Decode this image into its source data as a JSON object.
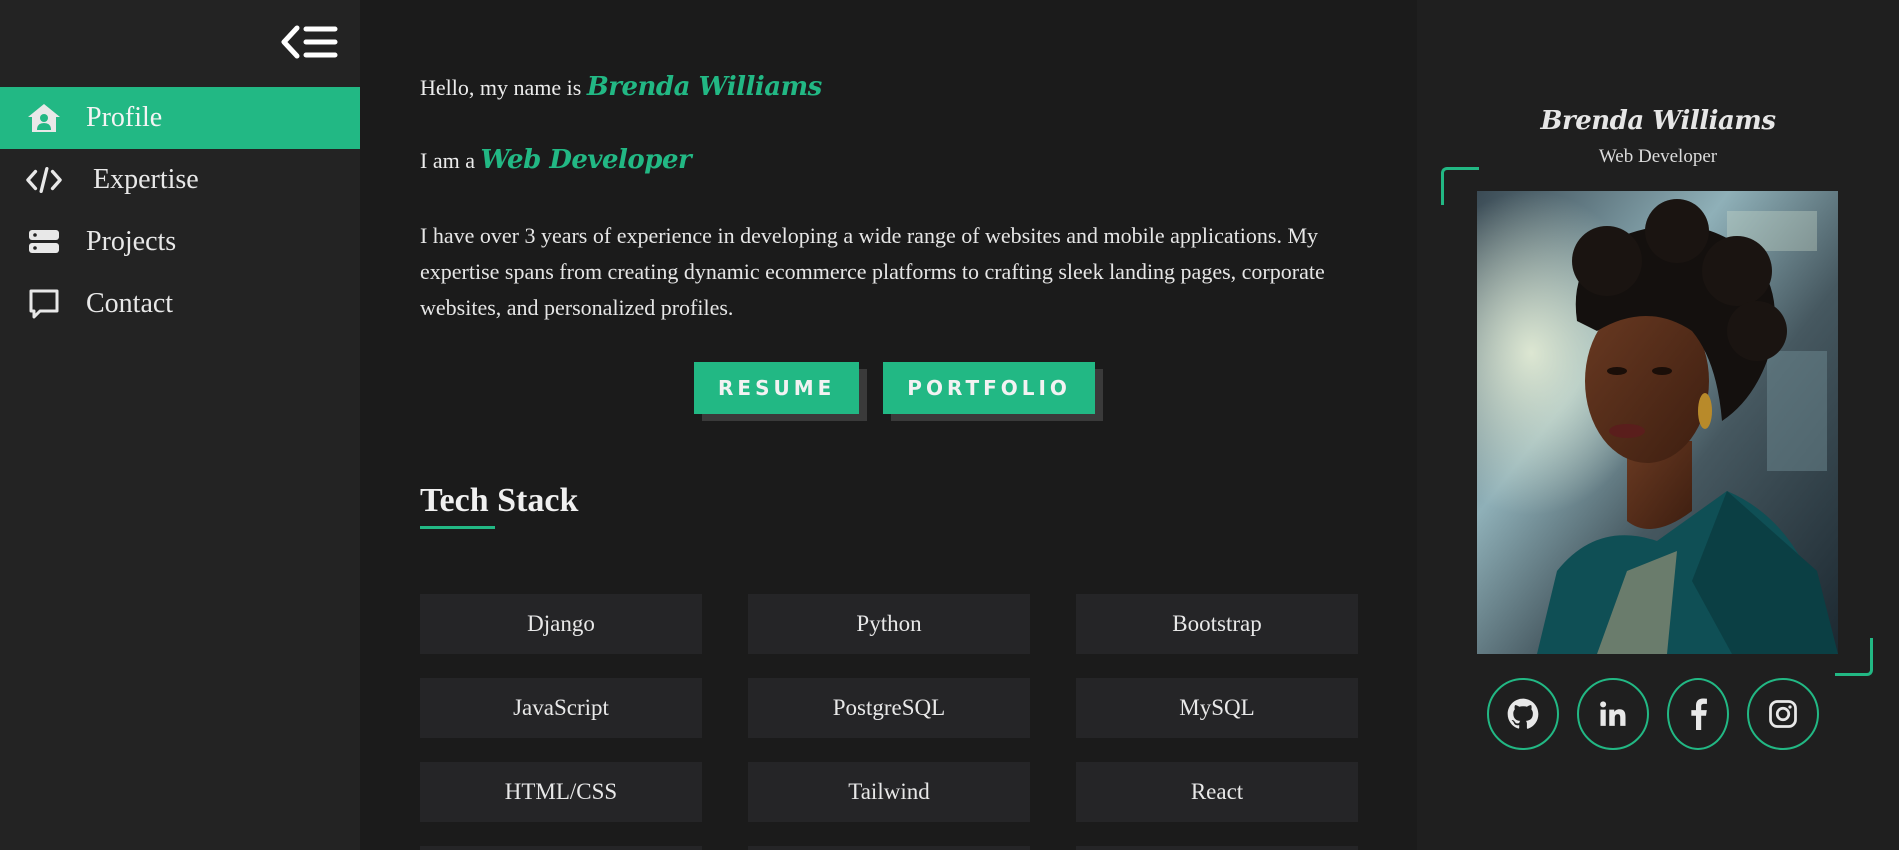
{
  "sidebar": {
    "toggle_icon": "collapse-menu-icon",
    "items": [
      {
        "label": "Profile",
        "icon": "home-user-icon",
        "active": true
      },
      {
        "label": "Expertise",
        "icon": "code-icon",
        "active": false
      },
      {
        "label": "Projects",
        "icon": "server-icon",
        "active": false
      },
      {
        "label": "Contact",
        "icon": "chat-icon",
        "active": false
      }
    ]
  },
  "intro": {
    "greeting_prefix": "Hello, my name is",
    "name": "Brenda Williams",
    "role_prefix": "I am a",
    "role": "Web Developer",
    "bio": "I have over 3 years of experience in developing a wide range of websites and mobile applications. My expertise spans from creating dynamic ecommerce platforms to crafting sleek landing pages, corporate websites, and personalized profiles."
  },
  "buttons": {
    "resume": "RESUME",
    "portfolio": "PORTFOLIO"
  },
  "tech_stack": {
    "title": "Tech Stack",
    "items": [
      "Django",
      "Python",
      "Bootstrap",
      "JavaScript",
      "PostgreSQL",
      "MySQL",
      "HTML/CSS",
      "Tailwind",
      "React"
    ]
  },
  "profile_card": {
    "name": "Brenda Williams",
    "role": "Web Developer",
    "socials": [
      "github-icon",
      "linkedin-icon",
      "facebook-icon",
      "instagram-icon"
    ]
  },
  "colors": {
    "accent": "#22b884",
    "background": "#1b1b1b",
    "sidebar": "#232323"
  }
}
